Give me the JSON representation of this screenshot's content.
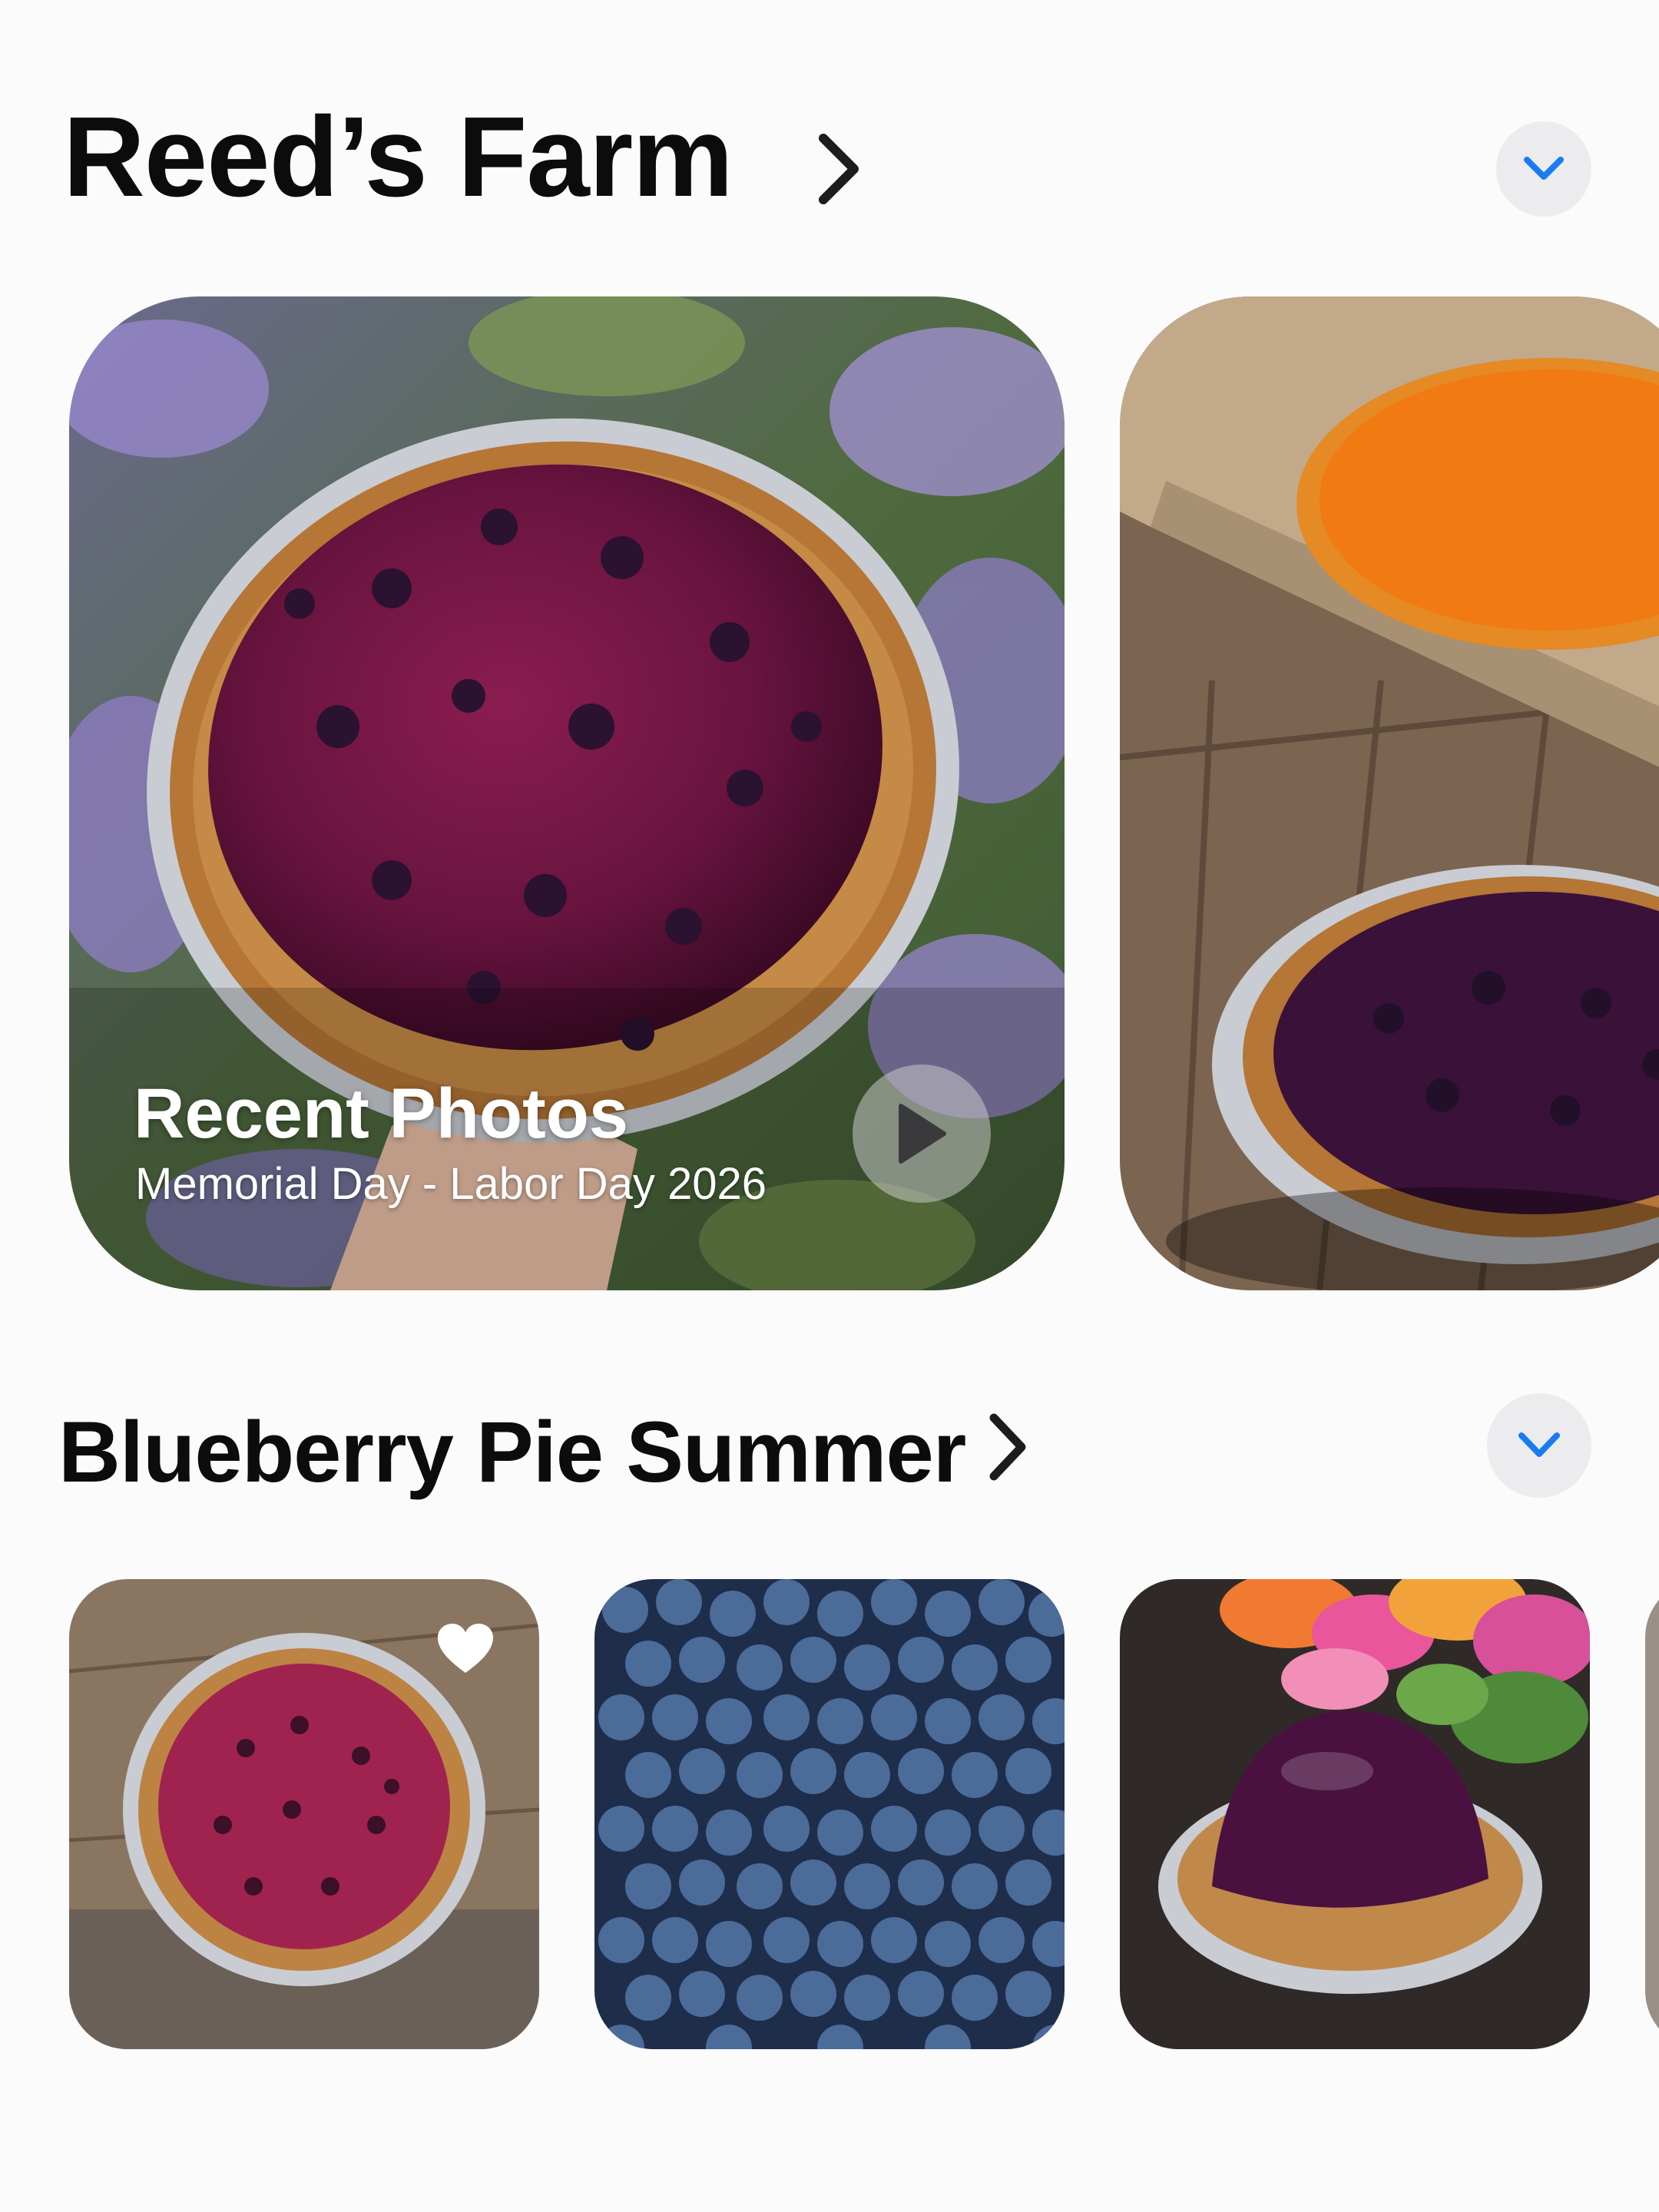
{
  "sections": [
    {
      "title": "Reed’s Farm",
      "featured": {
        "title": "Recent Photos",
        "subtitle": "Memorial Day - Labor Day 2026"
      }
    },
    {
      "title": "Blueberry Pie Summer"
    }
  ],
  "icons": {
    "chevron": "chevron-right-icon",
    "expand": "chevron-down-icon",
    "play": "play-icon",
    "favorite": "heart-icon"
  },
  "colors": {
    "accent": "#1a7cf2",
    "background": "#fbfbfc",
    "title": "#0c0c0d"
  }
}
